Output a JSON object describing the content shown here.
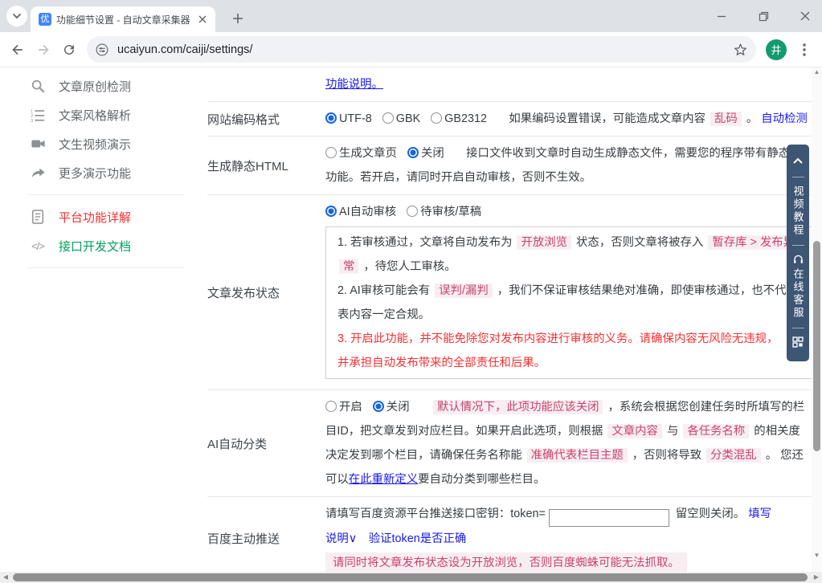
{
  "browser": {
    "tab_title": "功能细节设置 - 自动文章采集器",
    "favicon_letter": "优",
    "url": "ucaiyun.com/caiji/settings/",
    "avatar_letter": "井"
  },
  "colors": {
    "accent_blue": "#1766d8",
    "link_blue": "#1a1aee",
    "highlight_red": "#c9436b",
    "highlight_bg": "#f8eef2",
    "warning_red": "#f53131",
    "widget_navy": "#3d5674",
    "sidebar_green": "#05a05c"
  },
  "sidebar": {
    "items": [
      {
        "label": "文章原创检测",
        "icon": "search",
        "color": "gray"
      },
      {
        "label": "文案风格解析",
        "icon": "numbered-list",
        "color": "gray"
      },
      {
        "label": "文生视频演示",
        "icon": "video-camera",
        "color": "gray"
      },
      {
        "label": "更多演示功能",
        "icon": "share-arrow",
        "color": "gray",
        "divider_after": true
      },
      {
        "label": "平台功能详解",
        "icon": "document",
        "color": "red"
      },
      {
        "label": "接口开发文档",
        "icon": "code",
        "color": "green",
        "divider_after": true
      }
    ]
  },
  "settings": {
    "rows": [
      {
        "label": "",
        "lines": [
          [
            {
              "s": "link-u",
              "t": "功能说明。"
            }
          ]
        ]
      },
      {
        "label": "网站编码格式",
        "lines": [
          [
            {
              "s": "radio-on",
              "t": "UTF-8"
            },
            {
              "s": "radio-off",
              "t": "GBK"
            },
            {
              "s": "radio-off",
              "t": "GB2312"
            },
            {
              "s": "text",
              "t": "　如果编码设置错误，可能造成文章内容 "
            },
            {
              "s": "hl",
              "t": "乱码"
            },
            {
              "s": "text",
              "t": " 。 "
            },
            {
              "s": "link",
              "t": "自动检测"
            }
          ]
        ]
      },
      {
        "label": "生成静态HTML",
        "lines": [
          [
            {
              "s": "radio-off",
              "t": "生成文章页"
            },
            {
              "s": "radio-on",
              "t": "关闭"
            },
            {
              "s": "text",
              "t": "　接口文件收到文章时自动生成静态文件，需要您的程序带有静态"
            }
          ],
          [
            {
              "s": "text",
              "t": "功能。若开启，请同时开启自动审核，否则不生效。"
            }
          ]
        ]
      },
      {
        "label": "文章发布状态",
        "lines": [
          [
            {
              "s": "radio-on",
              "t": "AI自动审核"
            },
            {
              "s": "radio-off",
              "t": "待审核/草稿"
            }
          ]
        ],
        "box_lines": [
          [
            {
              "s": "text",
              "t": "1. 若审核通过，文章将自动发布为 "
            },
            {
              "s": "hl",
              "t": "开放浏览"
            },
            {
              "s": "text",
              "t": " 状态，否则文章将被存入 "
            },
            {
              "s": "hl",
              "t": "暂存库 > 发布异"
            }
          ],
          [
            {
              "s": "hl",
              "t": "常"
            },
            {
              "s": "text",
              "t": " ，待您人工审核。"
            }
          ],
          [
            {
              "s": "text",
              "t": "2. AI审核可能会有 "
            },
            {
              "s": "hl",
              "t": "误判/漏判"
            },
            {
              "s": "text",
              "t": " ，我们不保证审核结果绝对准确，即使审核通过，也不代"
            }
          ],
          [
            {
              "s": "text",
              "t": "表内容一定合规。"
            }
          ],
          [
            {
              "s": "red",
              "t": "3. 开启此功能，并不能免除您对发布内容进行审核的义务。请确保内容无风险无违规，"
            }
          ],
          [
            {
              "s": "red",
              "t": "并承担自动发布带来的全部责任和后果。"
            }
          ]
        ]
      },
      {
        "label": "AI自动分类",
        "lines": [
          [
            {
              "s": "radio-off",
              "t": "开启"
            },
            {
              "s": "radio-on",
              "t": "关闭"
            },
            {
              "s": "text",
              "t": "　"
            },
            {
              "s": "hl",
              "t": "默认情况下，此项功能应该关闭"
            },
            {
              "s": "text",
              "t": " ，系统会根据您创建任务时所填写的栏"
            }
          ],
          [
            {
              "s": "text",
              "t": "目ID，把文章发到对应栏目。如果开启此选项，则根据 "
            },
            {
              "s": "hl",
              "t": "文章内容"
            },
            {
              "s": "text",
              "t": " 与 "
            },
            {
              "s": "hl",
              "t": "各任务名称"
            },
            {
              "s": "text",
              "t": " 的相关度"
            }
          ],
          [
            {
              "s": "text",
              "t": "决定发到哪个栏目，请确保任务名称能 "
            },
            {
              "s": "hl",
              "t": "准确代表栏目主题"
            },
            {
              "s": "text",
              "t": " ，否则将导致 "
            },
            {
              "s": "hl",
              "t": "分类混乱"
            },
            {
              "s": "text",
              "t": " 。 您还"
            }
          ],
          [
            {
              "s": "text",
              "t": "可以"
            },
            {
              "s": "link-u",
              "t": "在此重新定义"
            },
            {
              "s": "text",
              "t": "要自动分类到哪些栏目。"
            }
          ]
        ]
      },
      {
        "label": "百度主动推送",
        "lines": [
          [
            {
              "s": "text",
              "t": "请填写百度资源平台推送接口密钥：token="
            },
            {
              "s": "input",
              "t": ""
            },
            {
              "s": "text",
              "t": " 留空则关闭。 "
            },
            {
              "s": "link",
              "t": "填写"
            }
          ],
          [
            {
              "s": "link",
              "t": "说明∨"
            },
            {
              "s": "text",
              "t": "　"
            },
            {
              "s": "link",
              "t": "验证token是否正确"
            }
          ],
          [
            {
              "s": "hlblock",
              "t": "请同时将文章发布状态设为开放浏览，否则百度蜘蛛可能无法抓取。"
            }
          ]
        ]
      }
    ]
  },
  "float_widget": {
    "video_label": "视频教程",
    "service_label": "在线客服"
  }
}
